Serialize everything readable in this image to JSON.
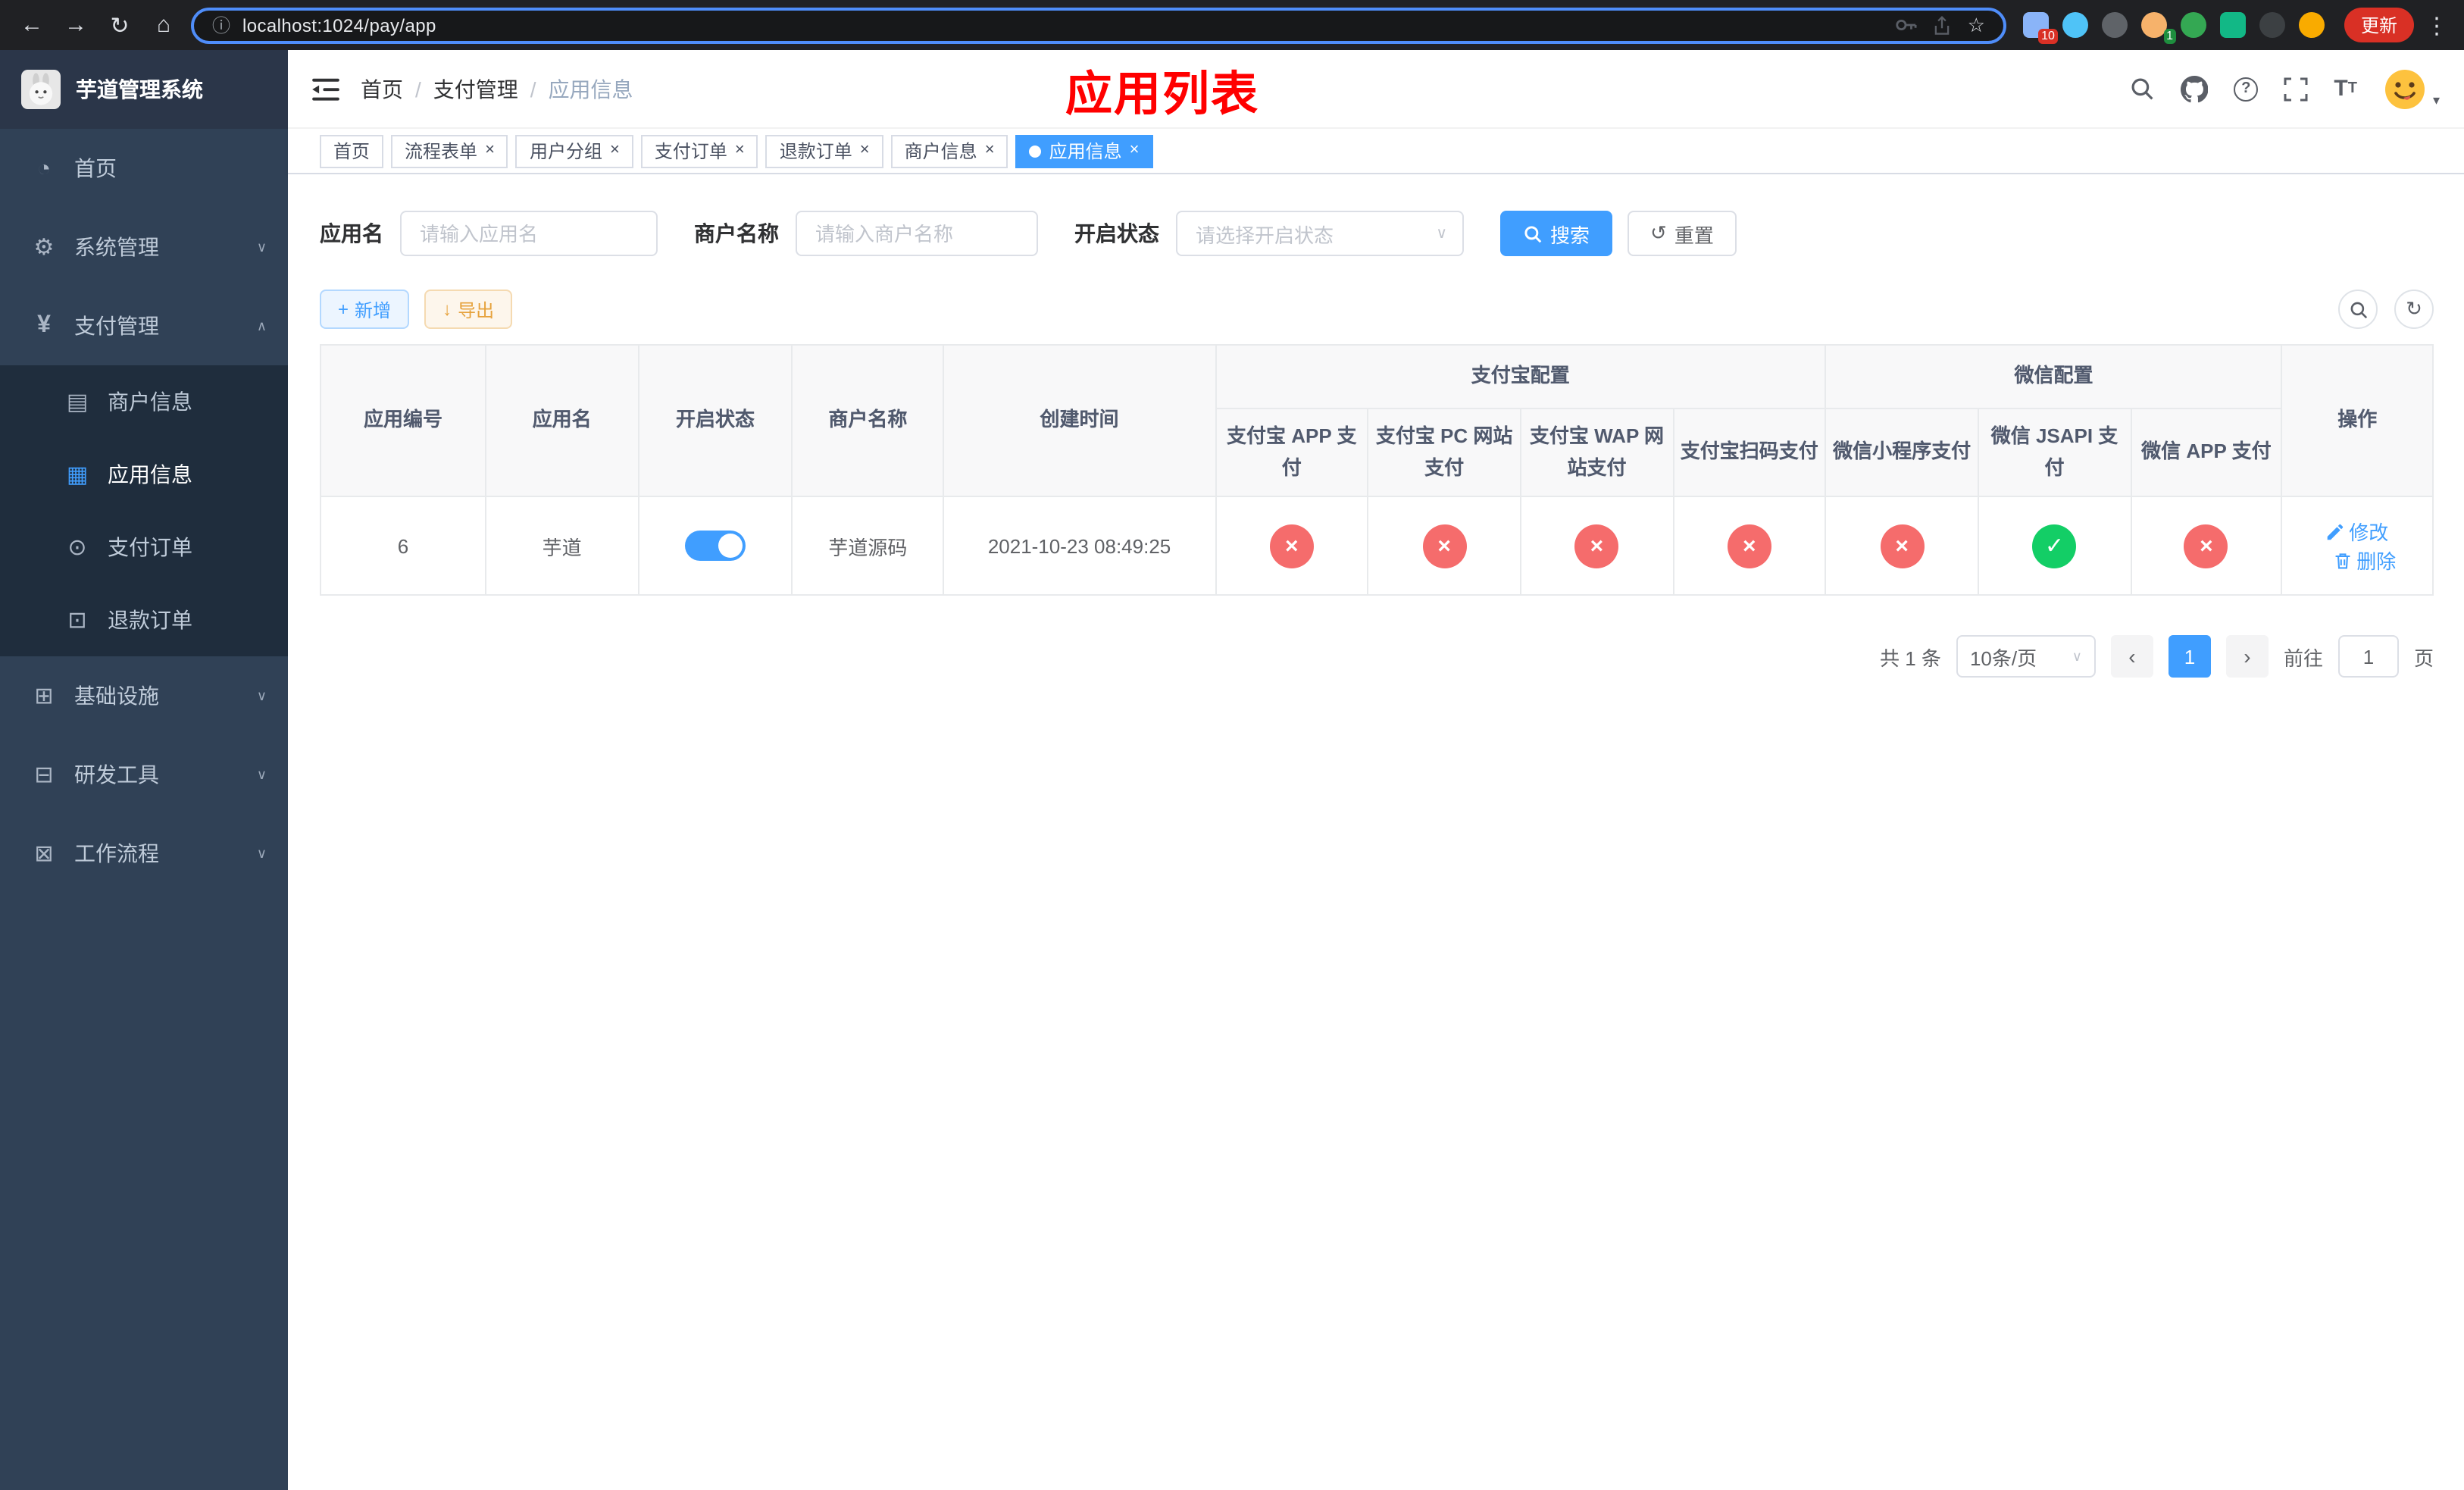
{
  "colors": {
    "primary": "#409eff",
    "danger": "#f56c6c",
    "success": "#13ce66",
    "warning": "#e6a23c",
    "title_red": "#ff0000",
    "sidebar_bg": "#304156",
    "submenu_bg": "#1f2d3d"
  },
  "icons": {
    "back": "←",
    "forward": "→",
    "reload": "↻",
    "home": "⌂",
    "info": "ⓘ",
    "star": "☆",
    "dots": "⋮",
    "dashboard": "◔",
    "gear": "⚙",
    "yen": "¥",
    "merchant": "▤",
    "app": "▦",
    "order": "⊙",
    "refund": "⊡",
    "infra": "⊞",
    "devtools": "⊟",
    "workflow": "⊠",
    "chevron_down": "∨",
    "chevron_up": "∧",
    "caret_down": "▾",
    "plus": "+",
    "download": "↓",
    "refresh": "↻",
    "reset": "↺",
    "prev": "‹",
    "next": "›",
    "check": "✓",
    "cross": "×",
    "question": "?",
    "slash": "/"
  },
  "browser": {
    "url": "localhost:1024/pay/app",
    "update_label": "更新",
    "extension_badges": [
      "10",
      "1"
    ]
  },
  "sidebar": {
    "title": "芋道管理系统",
    "items": [
      {
        "label": "首页"
      },
      {
        "label": "系统管理",
        "expandable": true
      },
      {
        "label": "支付管理",
        "expandable": true,
        "expanded": true,
        "children": [
          {
            "label": "商户信息"
          },
          {
            "label": "应用信息",
            "active": true
          },
          {
            "label": "支付订单"
          },
          {
            "label": "退款订单"
          }
        ]
      },
      {
        "label": "基础设施",
        "expandable": true
      },
      {
        "label": "研发工具",
        "expandable": true
      },
      {
        "label": "工作流程",
        "expandable": true
      }
    ]
  },
  "navbar": {
    "breadcrumb": [
      "首页",
      "支付管理",
      "应用信息"
    ],
    "page_title": "应用列表"
  },
  "tabs": [
    {
      "label": "首页",
      "closable": false,
      "active": false
    },
    {
      "label": "流程表单",
      "closable": true,
      "active": false
    },
    {
      "label": "用户分组",
      "closable": true,
      "active": false
    },
    {
      "label": "支付订单",
      "closable": true,
      "active": false
    },
    {
      "label": "退款订单",
      "closable": true,
      "active": false
    },
    {
      "label": "商户信息",
      "closable": true,
      "active": false
    },
    {
      "label": "应用信息",
      "closable": true,
      "active": true
    }
  ],
  "filters": {
    "app_name_label": "应用名",
    "app_name_placeholder": "请输入应用名",
    "merchant_name_label": "商户名称",
    "merchant_name_placeholder": "请输入商户名称",
    "status_label": "开启状态",
    "status_placeholder": "请选择开启状态",
    "search_button": "搜索",
    "reset_button": "重置"
  },
  "toolbar": {
    "add_button": "新增",
    "export_button": "导出"
  },
  "table": {
    "headers": {
      "app_id": "应用编号",
      "app_name": "应用名",
      "status": "开启状态",
      "merchant_name": "商户名称",
      "create_time": "创建时间",
      "alipay_group": "支付宝配置",
      "wechat_group": "微信配置",
      "actions": "操作",
      "sub": [
        "支付宝 APP 支付",
        "支付宝 PC 网站支付",
        "支付宝 WAP 网站支付",
        "支付宝扫码支付",
        "微信小程序支付",
        "微信 JSAPI 支付",
        "微信 APP 支付"
      ]
    },
    "rows": [
      {
        "app_id": "6",
        "app_name": "芋道",
        "status_on": true,
        "merchant_name": "芋道源码",
        "create_time": "2021-10-23 08:49:25",
        "configs": [
          false,
          false,
          false,
          false,
          false,
          true,
          false
        ],
        "edit_label": "修改",
        "delete_label": "删除"
      }
    ]
  },
  "pagination": {
    "total": "共 1 条",
    "page_size": "10条/页",
    "page": "1",
    "goto_label": "前往",
    "goto_value": "1",
    "unit": "页"
  }
}
